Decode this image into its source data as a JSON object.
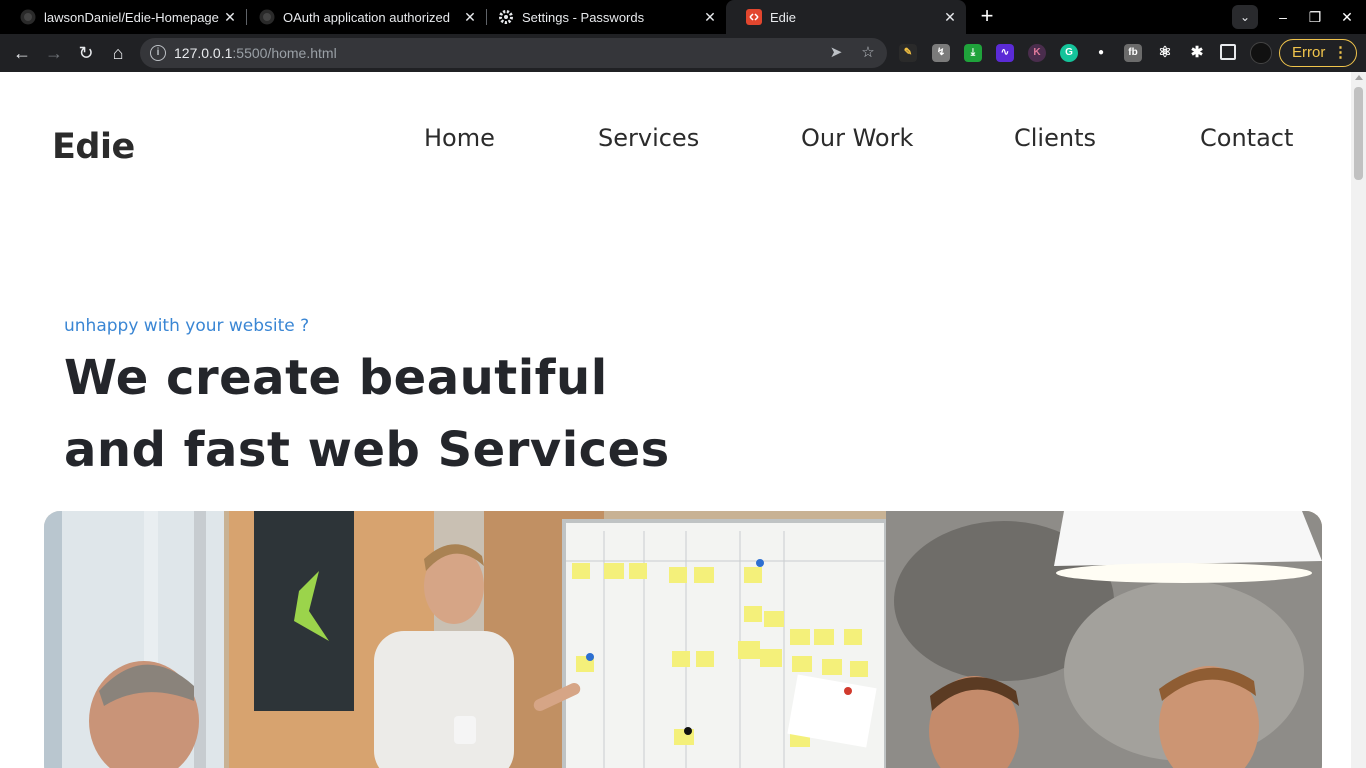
{
  "browser": {
    "tabs": [
      {
        "title": "lawsonDaniel/Edie-Homepage",
        "icon": "github-icon"
      },
      {
        "title": "OAuth application authorized",
        "icon": "github-icon"
      },
      {
        "title": "Settings - Passwords",
        "icon": "gear-icon"
      },
      {
        "title": "Edie",
        "icon": "site-favicon",
        "active": true
      }
    ],
    "url_host": "127.0.0.1",
    "url_rest": ":5500/home.html",
    "error_label": "Error",
    "accent": "#f0c44c"
  },
  "site": {
    "logo": "Edie",
    "nav": [
      "Home",
      "Services",
      "Our Work",
      "Clients",
      "Contact"
    ],
    "tagline": "unhappy with your website ?",
    "headline_line1": "We create beautiful",
    "headline_line2": "and fast web Services",
    "colors": {
      "tagline": "#3a86d4",
      "text": "#24262b"
    },
    "hero_image": "team-meeting-whiteboard-photo"
  }
}
